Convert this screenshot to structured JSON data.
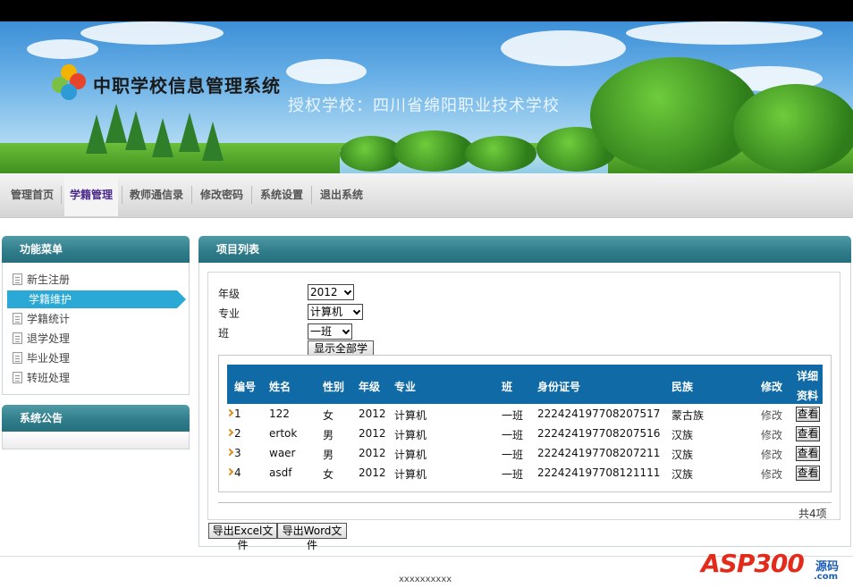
{
  "header": {
    "brand": "中职学校信息管理系统",
    "school": "授权学校：四川省绵阳职业技术学校"
  },
  "nav": {
    "items": [
      {
        "label": "管理首页"
      },
      {
        "label": "学籍管理"
      },
      {
        "label": "教师通信录"
      },
      {
        "label": "修改密码"
      },
      {
        "label": "系统设置"
      },
      {
        "label": "退出系统"
      }
    ],
    "active_index": 1
  },
  "sidebar": {
    "menu_title": "功能菜单",
    "items": [
      {
        "label": "新生注册"
      },
      {
        "label": "学籍维护"
      },
      {
        "label": "学籍统计"
      },
      {
        "label": "退学处理"
      },
      {
        "label": "毕业处理"
      },
      {
        "label": "转班处理"
      }
    ],
    "active_index": 1,
    "notice_title": "系统公告"
  },
  "main": {
    "title": "项目列表",
    "filters": {
      "grade_label": "年级",
      "grade_value": "2012",
      "major_label": "专业",
      "major_value": "计算机",
      "class_label": "班",
      "class_value": "一班",
      "show_all_button": "显示全部学生"
    },
    "table": {
      "columns": [
        "编号",
        "姓名",
        "性别",
        "年级",
        "专业",
        "班",
        "身份证号",
        "民族",
        "修改",
        "详细",
        "资料"
      ],
      "rows": [
        {
          "id": "1",
          "name": "122",
          "gender": "女",
          "grade": "2012",
          "major": "计算机",
          "class": "一班",
          "idcard": "222424197708207517",
          "ethnicity": "蒙古族",
          "edit": "修改",
          "view": "查看"
        },
        {
          "id": "2",
          "name": "ertok",
          "gender": "男",
          "grade": "2012",
          "major": "计算机",
          "class": "一班",
          "idcard": "222424197708207516",
          "ethnicity": "汉族",
          "edit": "修改",
          "view": "查看"
        },
        {
          "id": "3",
          "name": "waer",
          "gender": "男",
          "grade": "2012",
          "major": "计算机",
          "class": "一班",
          "idcard": "222424197708207211",
          "ethnicity": "汉族",
          "edit": "修改",
          "view": "查看"
        },
        {
          "id": "4",
          "name": "asdf",
          "gender": "女",
          "grade": "2012",
          "major": "计算机",
          "class": "一班",
          "idcard": "222424197708121111",
          "ethnicity": "汉族",
          "edit": "修改",
          "view": "查看"
        }
      ]
    },
    "total": "共4项",
    "export_excel": "导出Excel文件",
    "export_word": "导出Word文件"
  },
  "footer": {
    "text": "xxxxxxxxxx",
    "watermark": "ASP300",
    "watermark_cn": "源码",
    "watermark_domain": ".com"
  }
}
